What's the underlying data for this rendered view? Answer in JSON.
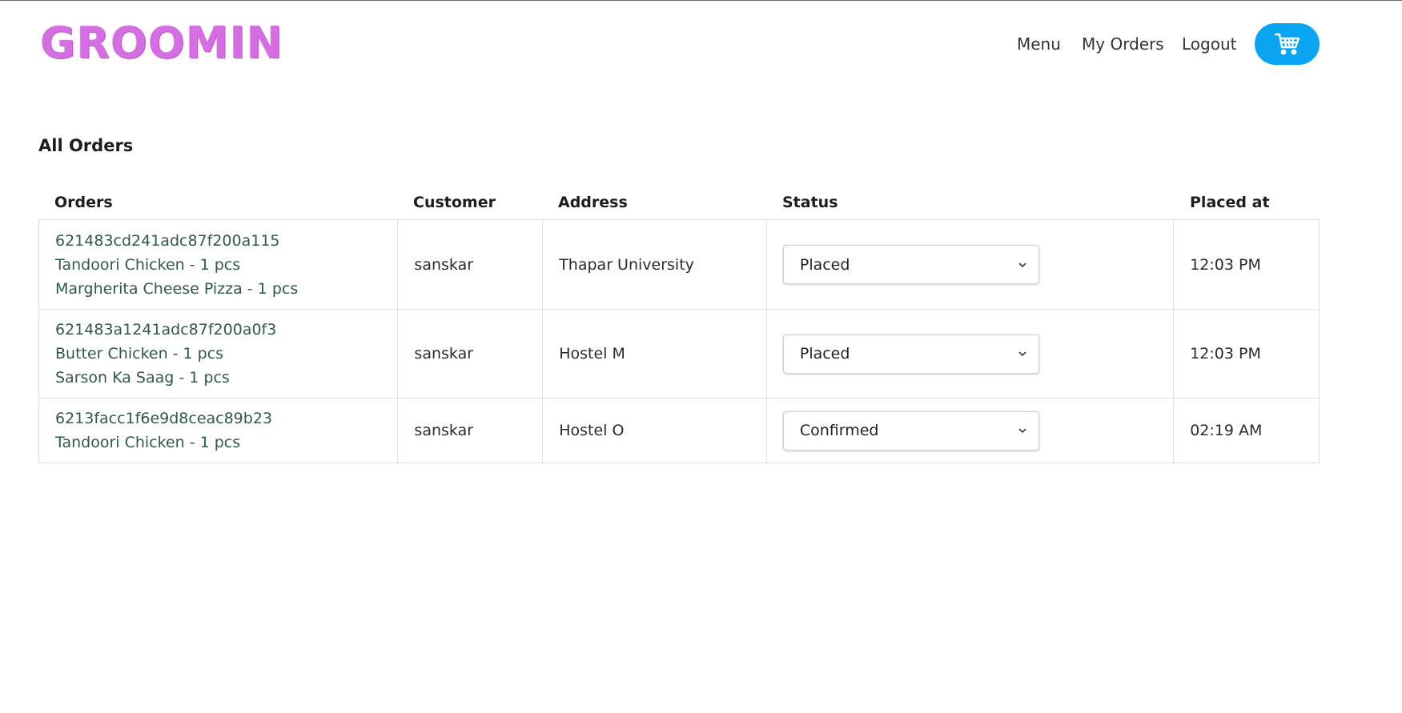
{
  "header": {
    "logo": "GROOMIN",
    "nav": {
      "menu": "Menu",
      "my_orders": "My Orders",
      "logout": "Logout"
    },
    "cart_icon": "cart-icon",
    "accent_color": "#0aa5f2",
    "logo_color": "#d66ee3"
  },
  "page": {
    "title": "All Orders"
  },
  "table": {
    "headers": [
      "Orders",
      "Customer",
      "Address",
      "Status",
      "Placed at"
    ],
    "rows": [
      {
        "order_id": "621483cd241adc87f200a115",
        "items": [
          "Tandoori Chicken - 1 pcs",
          "Margherita Cheese Pizza - 1 pcs"
        ],
        "customer": "sanskar",
        "address": "Thapar University",
        "status": "Placed",
        "placed_at": "12:03 PM"
      },
      {
        "order_id": "621483a1241adc87f200a0f3",
        "items": [
          "Butter Chicken - 1 pcs",
          "Sarson Ka Saag - 1 pcs"
        ],
        "customer": "sanskar",
        "address": "Hostel M",
        "status": "Placed",
        "placed_at": "12:03 PM"
      },
      {
        "order_id": "6213facc1f6e9d8ceac89b23",
        "items": [
          "Tandoori Chicken - 1 pcs"
        ],
        "customer": "sanskar",
        "address": "Hostel O",
        "status": "Confirmed",
        "placed_at": "02:19 AM"
      }
    ]
  }
}
